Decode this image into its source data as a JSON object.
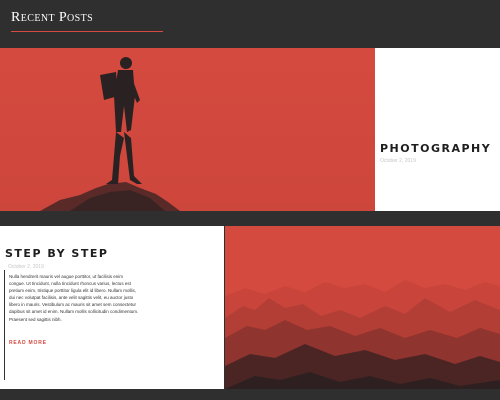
{
  "header": {
    "title": "Recent Posts"
  },
  "posts": [
    {
      "title": "PHOTOGRAPHY",
      "date": "October 2, 2019",
      "image_icon": "hiker-on-rock-image"
    },
    {
      "title": "STEP BY STEP",
      "date": "October 2, 2019",
      "excerpt": "Nulla hendrerit mauris vel augue porttitor, ut facilisis enim congue. Ut tincidunt, nulla tincidunt rhoncus varius, lectus est pretium enim, tristique porttitor ligula elit id libero. Nullam mollis, dui nec volutpat facilisis, ante velit sagittis velit, eu auctor justo libero in mauris. Vestibulum ac mauris sit amet sem consectetur dapibus sit amet id enim. Nullam mollis sollicitudin condimentum. Praesent sed sagittis nibh.",
      "read_more": "READ MORE",
      "image_icon": "mountain-range-image"
    }
  ],
  "colors": {
    "accent": "#d54a3f",
    "background": "#2f2f2f",
    "card": "#ffffff"
  }
}
